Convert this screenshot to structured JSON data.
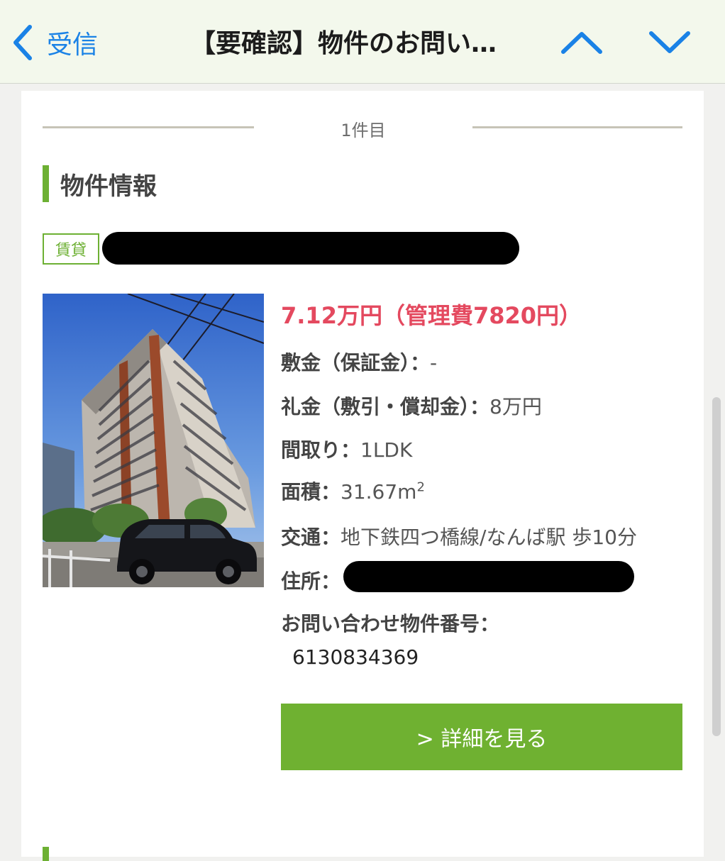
{
  "nav": {
    "back_label": "受信",
    "subject": "【要確認】物件のお問い…"
  },
  "listing": {
    "item_count": "1件目",
    "section_title": "物件情報",
    "tag": "賃貸",
    "price": "7.12万円（管理費7820円）",
    "deposit_label": "敷金（保証金）：",
    "deposit_value": "-",
    "key_money_label": "礼金（敷引・償却金）：",
    "key_money_value": "8万円",
    "layout_label": "間取り：",
    "layout_value": "1LDK",
    "area_label": "面積：",
    "area_value": "31.67m",
    "area_superscript": "2",
    "transit_label": "交通：",
    "transit_value": "地下鉄四つ橋線/なんば駅 歩10分",
    "address_label": "住所：",
    "inquiry_label": "お問い合わせ物件番号：",
    "inquiry_number": "6130834369",
    "detail_button": "> 詳細を見る"
  },
  "colors": {
    "accent_green": "#6db033",
    "price_red": "#e4495f",
    "ios_blue": "#1a82e6"
  }
}
